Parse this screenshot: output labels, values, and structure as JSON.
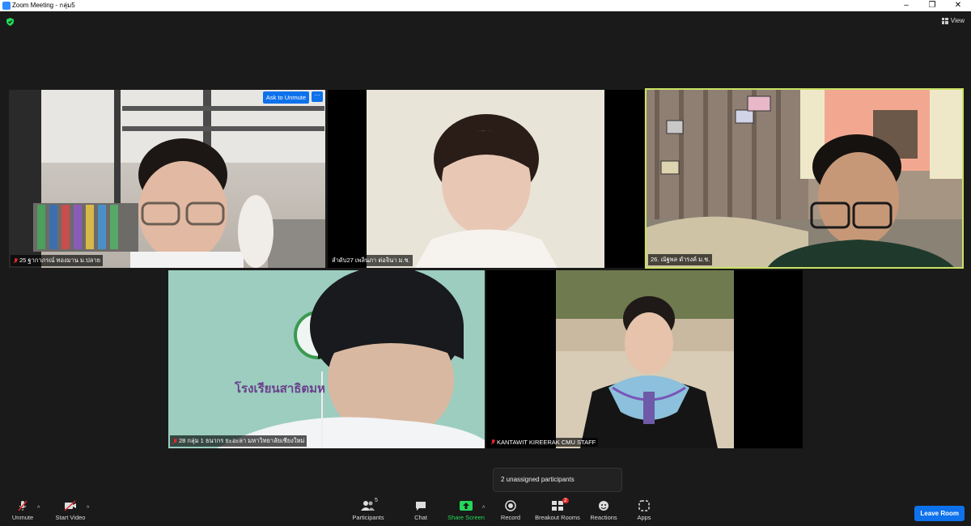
{
  "window": {
    "title": "Zoom Meeting - กลุ่ม5",
    "minimize": "–",
    "maximize": "❐",
    "close": "✕"
  },
  "top_right": {
    "view_label": "View"
  },
  "tiles": [
    {
      "name": "25 ฐากาภรณ์ ทองมาน ม.ปลาย",
      "muted": true,
      "ask_unmute": "Ask to Unmute",
      "more": "···"
    },
    {
      "name": "ลำดับ27 เพลินภา ต่อจินา ม.ช.",
      "muted": false
    },
    {
      "name": "26. ณัฐพล ดำรงค์ ม.ช.",
      "muted": false,
      "active_speaker": true
    },
    {
      "name": "28 กลุ่ม 1 ธนากร ยะอะลา มหาวิทยาลัยเชียงใหม่",
      "muted": true,
      "bg_text": "โรงเรียนสาธิตมห"
    },
    {
      "name": "KANTAWIT KIREERAK CMU STAFF",
      "muted": true
    }
  ],
  "popup": {
    "text": "2 unassigned participants"
  },
  "toolbar": {
    "unmute": "Unmute",
    "start_video": "Start Video",
    "participants": "Participants",
    "participants_count": "5",
    "chat": "Chat",
    "share_screen": "Share Screen",
    "record": "Record",
    "breakout_rooms": "Breakout Rooms",
    "breakout_badge": "2",
    "reactions": "Reactions",
    "apps": "Apps",
    "leave": "Leave Room"
  },
  "colors": {
    "accent": "#0e72ed",
    "share_green": "#23d959",
    "speaker_border": "#c9e265",
    "muted_red": "#e02828"
  }
}
